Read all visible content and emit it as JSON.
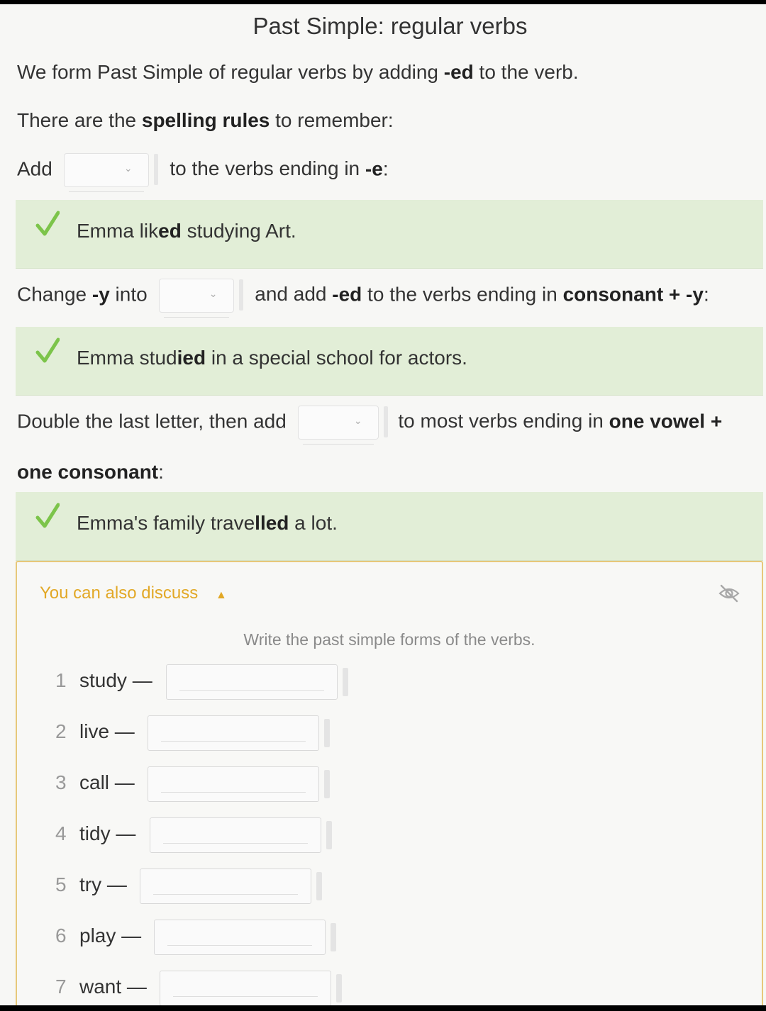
{
  "title": "Past Simple: regular verbs",
  "intro": {
    "pre": "We form Past Simple of regular verbs by adding ",
    "bold": "-ed",
    "post": " to the verb."
  },
  "spelling": {
    "pre": "There are the ",
    "bold": "spelling rules",
    "post": " to remember:"
  },
  "rule1": {
    "pre": "Add",
    "post_pre": "to the verbs ending in ",
    "post_bold": "-e",
    "post_end": ":",
    "dropdown_value": ""
  },
  "example1": {
    "pre": "Emma lik",
    "bold": "ed",
    "post": " studying Art."
  },
  "rule2": {
    "pre": "Change ",
    "pre_bold": "-y",
    "pre_end": " into",
    "mid_pre": "and add ",
    "mid_bold": "-ed",
    "mid_post": " to the verbs ending in ",
    "end_bold": "consonant + -y",
    "end": ":",
    "dropdown_value": ""
  },
  "example2": {
    "pre": "Emma stud",
    "bold": "ied",
    "post": " in a special school for actors."
  },
  "rule3": {
    "pre": "Double the last letter, then add",
    "post_pre": "to most verbs ending in ",
    "post_bold": "one vowel +",
    "line2_bold": "one consonant",
    "line2_end": ":",
    "dropdown_value": ""
  },
  "example3": {
    "pre": "Emma's family trave",
    "bold": "lled",
    "post": " a lot."
  },
  "discuss": {
    "heading": "You can also discuss",
    "instruction": "Write the past simple forms of the verbs.",
    "items": [
      {
        "num": "1",
        "verb": "study —",
        "value": ""
      },
      {
        "num": "2",
        "verb": "live —",
        "value": ""
      },
      {
        "num": "3",
        "verb": "call —",
        "value": ""
      },
      {
        "num": "4",
        "verb": "tidy —",
        "value": ""
      },
      {
        "num": "5",
        "verb": "try —",
        "value": ""
      },
      {
        "num": "6",
        "verb": "play —",
        "value": ""
      },
      {
        "num": "7",
        "verb": "want —",
        "value": ""
      }
    ]
  },
  "colors": {
    "example_bg": "#e2eed7",
    "check": "#7cc44a",
    "discuss_accent": "#e2a826",
    "discuss_border": "#e7c87a"
  },
  "icons": {
    "check": "check-icon",
    "dropdown": "chevron-down-icon",
    "collapse": "chevron-up-icon",
    "hide": "eye-slash-icon"
  }
}
